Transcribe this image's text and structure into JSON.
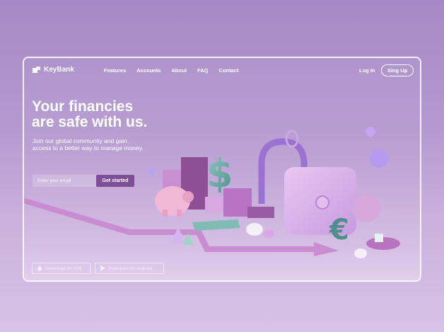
{
  "brand": {
    "name": "KeyBank",
    "logo_icon": "key-logo-icon"
  },
  "nav": {
    "items": [
      {
        "label": "Features"
      },
      {
        "label": "Accounts"
      },
      {
        "label": "About"
      },
      {
        "label": "FAQ"
      },
      {
        "label": "Contact"
      }
    ],
    "login_label": "Log In",
    "signup_label": "Sing Up"
  },
  "hero": {
    "headline_line1": "Your financies",
    "headline_line2": "are safe with us.",
    "sub_line1": "Join our global community and gain",
    "sub_line2": "access to a better way to manage money.",
    "email_placeholder": "Enter your email",
    "cta_label": "Get started"
  },
  "downloads": {
    "ios_label": "Download for IOS",
    "android_label": "Download for Android",
    "ios_icon": "apple-icon",
    "android_icon": "play-store-icon"
  },
  "colors": {
    "background": "#b59ad0",
    "accent": "#7e4f97",
    "frame_border": "#ffffff"
  }
}
